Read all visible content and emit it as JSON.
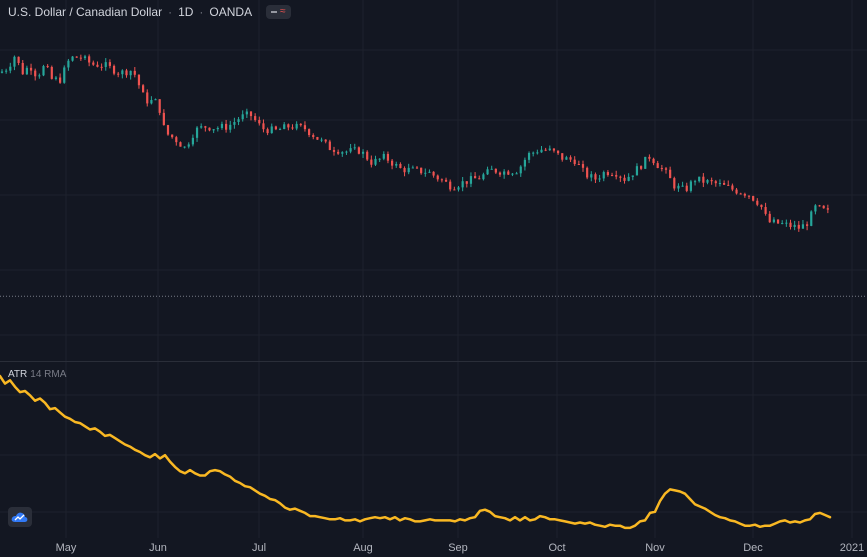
{
  "header": {
    "pair": "U.S. Dollar / Canadian Dollar",
    "interval": "1D",
    "exchange": "OANDA",
    "separator": "·"
  },
  "indicator": {
    "name": "ATR",
    "params": "14 RMA"
  },
  "logo_icon": "tradingview-cloud-icon",
  "colors": {
    "background": "#131722",
    "up": "#26a69a",
    "down": "#ef5350",
    "atr_line": "#f9b823",
    "grid": "#1e222d"
  },
  "chart_data": [
    {
      "type": "candlestick",
      "title": "U.S. Dollar / Canadian Dollar",
      "x_ticks": [
        "May",
        "Jun",
        "Jul",
        "Aug",
        "Sep",
        "Oct",
        "Nov",
        "Dec",
        "2021"
      ],
      "ylim": [
        1.2621,
        1.4387
      ],
      "current_value": 1.287,
      "y_axis_shown": false,
      "grid": true,
      "trend_points": [
        {
          "x": 0,
          "close": 1.4143
        },
        {
          "x": 8,
          "close": 1.4174
        },
        {
          "x": 15,
          "close": 1.4244
        },
        {
          "x": 22,
          "close": 1.4143
        },
        {
          "x": 30,
          "close": 1.4185
        },
        {
          "x": 37,
          "close": 1.4125
        },
        {
          "x": 45,
          "close": 1.4185
        },
        {
          "x": 52,
          "close": 1.4104
        },
        {
          "x": 60,
          "close": 1.4104
        },
        {
          "x": 70,
          "close": 1.4227
        },
        {
          "x": 80,
          "close": 1.4234
        },
        {
          "x": 92,
          "close": 1.4192
        },
        {
          "x": 105,
          "close": 1.4185
        },
        {
          "x": 120,
          "close": 1.4143
        },
        {
          "x": 133,
          "close": 1.416
        },
        {
          "x": 145,
          "close": 1.3986
        },
        {
          "x": 158,
          "close": 1.3976
        },
        {
          "x": 165,
          "close": 1.3802
        },
        {
          "x": 175,
          "close": 1.3767
        },
        {
          "x": 185,
          "close": 1.3715
        },
        {
          "x": 195,
          "close": 1.3816
        },
        {
          "x": 205,
          "close": 1.3837
        },
        {
          "x": 215,
          "close": 1.383
        },
        {
          "x": 228,
          "close": 1.3837
        },
        {
          "x": 240,
          "close": 1.3889
        },
        {
          "x": 250,
          "close": 1.3906
        },
        {
          "x": 262,
          "close": 1.3826
        },
        {
          "x": 275,
          "close": 1.3812
        },
        {
          "x": 290,
          "close": 1.384
        },
        {
          "x": 305,
          "close": 1.3826
        },
        {
          "x": 318,
          "close": 1.3767
        },
        {
          "x": 330,
          "close": 1.3715
        },
        {
          "x": 345,
          "close": 1.3694
        },
        {
          "x": 360,
          "close": 1.3701
        },
        {
          "x": 372,
          "close": 1.3631
        },
        {
          "x": 385,
          "close": 1.3663
        },
        {
          "x": 400,
          "close": 1.3596
        },
        {
          "x": 415,
          "close": 1.3586
        },
        {
          "x": 428,
          "close": 1.3579
        },
        {
          "x": 440,
          "close": 1.3537
        },
        {
          "x": 452,
          "close": 1.3495
        },
        {
          "x": 465,
          "close": 1.3523
        },
        {
          "x": 480,
          "close": 1.3547
        },
        {
          "x": 492,
          "close": 1.3589
        },
        {
          "x": 505,
          "close": 1.3579
        },
        {
          "x": 518,
          "close": 1.3589
        },
        {
          "x": 528,
          "close": 1.3676
        },
        {
          "x": 540,
          "close": 1.3708
        },
        {
          "x": 552,
          "close": 1.3697
        },
        {
          "x": 563,
          "close": 1.3655
        },
        {
          "x": 575,
          "close": 1.3645
        },
        {
          "x": 585,
          "close": 1.3565
        },
        {
          "x": 595,
          "close": 1.3537
        },
        {
          "x": 605,
          "close": 1.3579
        },
        {
          "x": 615,
          "close": 1.3579
        },
        {
          "x": 625,
          "close": 1.3537
        },
        {
          "x": 638,
          "close": 1.36
        },
        {
          "x": 650,
          "close": 1.3669
        },
        {
          "x": 658,
          "close": 1.3617
        },
        {
          "x": 665,
          "close": 1.3579
        },
        {
          "x": 675,
          "close": 1.3495
        },
        {
          "x": 685,
          "close": 1.3474
        },
        {
          "x": 695,
          "close": 1.3537
        },
        {
          "x": 705,
          "close": 1.3523
        },
        {
          "x": 715,
          "close": 1.3513
        },
        {
          "x": 725,
          "close": 1.3495
        },
        {
          "x": 735,
          "close": 1.3474
        },
        {
          "x": 748,
          "close": 1.3453
        },
        {
          "x": 760,
          "close": 1.3397
        },
        {
          "x": 768,
          "close": 1.3293
        },
        {
          "x": 778,
          "close": 1.3286
        },
        {
          "x": 790,
          "close": 1.3272
        },
        {
          "x": 800,
          "close": 1.3258
        },
        {
          "x": 808,
          "close": 1.3293
        },
        {
          "x": 815,
          "close": 1.3376
        },
        {
          "x": 822,
          "close": 1.3362
        },
        {
          "x": 828,
          "close": 1.3348
        }
      ]
    },
    {
      "type": "line",
      "title": "ATR 14 RMA",
      "ylim": [
        0,
        0.0145
      ],
      "x": [
        0,
        5,
        10,
        15,
        20,
        25,
        30,
        35,
        40,
        45,
        50,
        55,
        60,
        65,
        70,
        75,
        80,
        85,
        90,
        95,
        100,
        105,
        110,
        115,
        120,
        125,
        130,
        135,
        140,
        145,
        150,
        155,
        160,
        165,
        170,
        175,
        180,
        185,
        190,
        195,
        200,
        205,
        210,
        215,
        220,
        225,
        230,
        235,
        240,
        245,
        250,
        255,
        260,
        265,
        270,
        275,
        280,
        285,
        290,
        295,
        300,
        305,
        310,
        315,
        320,
        325,
        330,
        335,
        340,
        345,
        350,
        355,
        360,
        365,
        370,
        375,
        380,
        385,
        390,
        395,
        400,
        405,
        410,
        415,
        420,
        425,
        430,
        435,
        440,
        445,
        450,
        455,
        460,
        465,
        470,
        475,
        480,
        485,
        490,
        495,
        500,
        505,
        510,
        515,
        520,
        525,
        530,
        535,
        540,
        545,
        550,
        555,
        560,
        565,
        570,
        575,
        580,
        585,
        590,
        595,
        600,
        605,
        610,
        615,
        620,
        625,
        630,
        635,
        640,
        645,
        650,
        655,
        660,
        665,
        670,
        675,
        680,
        685,
        690,
        695,
        700,
        705,
        710,
        715,
        720,
        725,
        730,
        735,
        740,
        745,
        750,
        755,
        760,
        765,
        770,
        775,
        780,
        785,
        790,
        795,
        800,
        805,
        810,
        815,
        820,
        825,
        830
      ],
      "values": [
        0.0144,
        0.0137,
        0.014,
        0.0134,
        0.0129,
        0.013,
        0.0126,
        0.0121,
        0.0123,
        0.0119,
        0.0113,
        0.0114,
        0.011,
        0.0106,
        0.0104,
        0.0101,
        0.01,
        0.0097,
        0.0094,
        0.0095,
        0.0092,
        0.0088,
        0.0089,
        0.0086,
        0.0083,
        0.008,
        0.0078,
        0.0075,
        0.0073,
        0.007,
        0.0068,
        0.0071,
        0.0067,
        0.007,
        0.0064,
        0.0059,
        0.0055,
        0.0053,
        0.0056,
        0.0053,
        0.0051,
        0.0051,
        0.0055,
        0.0056,
        0.0055,
        0.0052,
        0.005,
        0.0046,
        0.0044,
        0.0041,
        0.004,
        0.0037,
        0.0034,
        0.0032,
        0.0029,
        0.0028,
        0.0025,
        0.0021,
        0.0019,
        0.002,
        0.0018,
        0.0016,
        0.0013,
        0.0013,
        0.0012,
        0.0011,
        0.001,
        0.001,
        0.0011,
        0.0009,
        0.0009,
        0.001,
        0.0008,
        0.001,
        0.0011,
        0.0012,
        0.0011,
        0.0012,
        0.001,
        0.0012,
        0.0009,
        0.0011,
        0.001,
        0.0008,
        0.0008,
        0.0009,
        0.001,
        0.0009,
        0.0009,
        0.0009,
        0.0009,
        0.0008,
        0.001,
        0.0009,
        0.0011,
        0.0012,
        0.0018,
        0.0019,
        0.0017,
        0.0013,
        0.0012,
        0.0011,
        0.0009,
        0.0012,
        0.0009,
        0.0012,
        0.0009,
        0.001,
        0.0013,
        0.0012,
        0.001,
        0.001,
        0.0009,
        0.0008,
        0.0007,
        0.0006,
        0.0007,
        0.0006,
        0.0007,
        0.0005,
        0.0004,
        0.0003,
        0.0005,
        0.0004,
        0.0004,
        0.0002,
        0.0002,
        0.0004,
        0.0008,
        0.0009,
        0.0016,
        0.0017,
        0.0027,
        0.0034,
        0.0038,
        0.0037,
        0.0036,
        0.0034,
        0.0029,
        0.0024,
        0.0022,
        0.002,
        0.0017,
        0.0014,
        0.0012,
        0.0011,
        0.0009,
        0.0008,
        0.0006,
        0.0004,
        0.0004,
        0.0005,
        0.0003,
        0.0004,
        0.0004,
        0.0006,
        0.0008,
        0.0009,
        0.0007,
        0.0008,
        0.0007,
        0.0009,
        0.001,
        0.0015,
        0.0016,
        0.0014,
        0.0012
      ]
    }
  ]
}
